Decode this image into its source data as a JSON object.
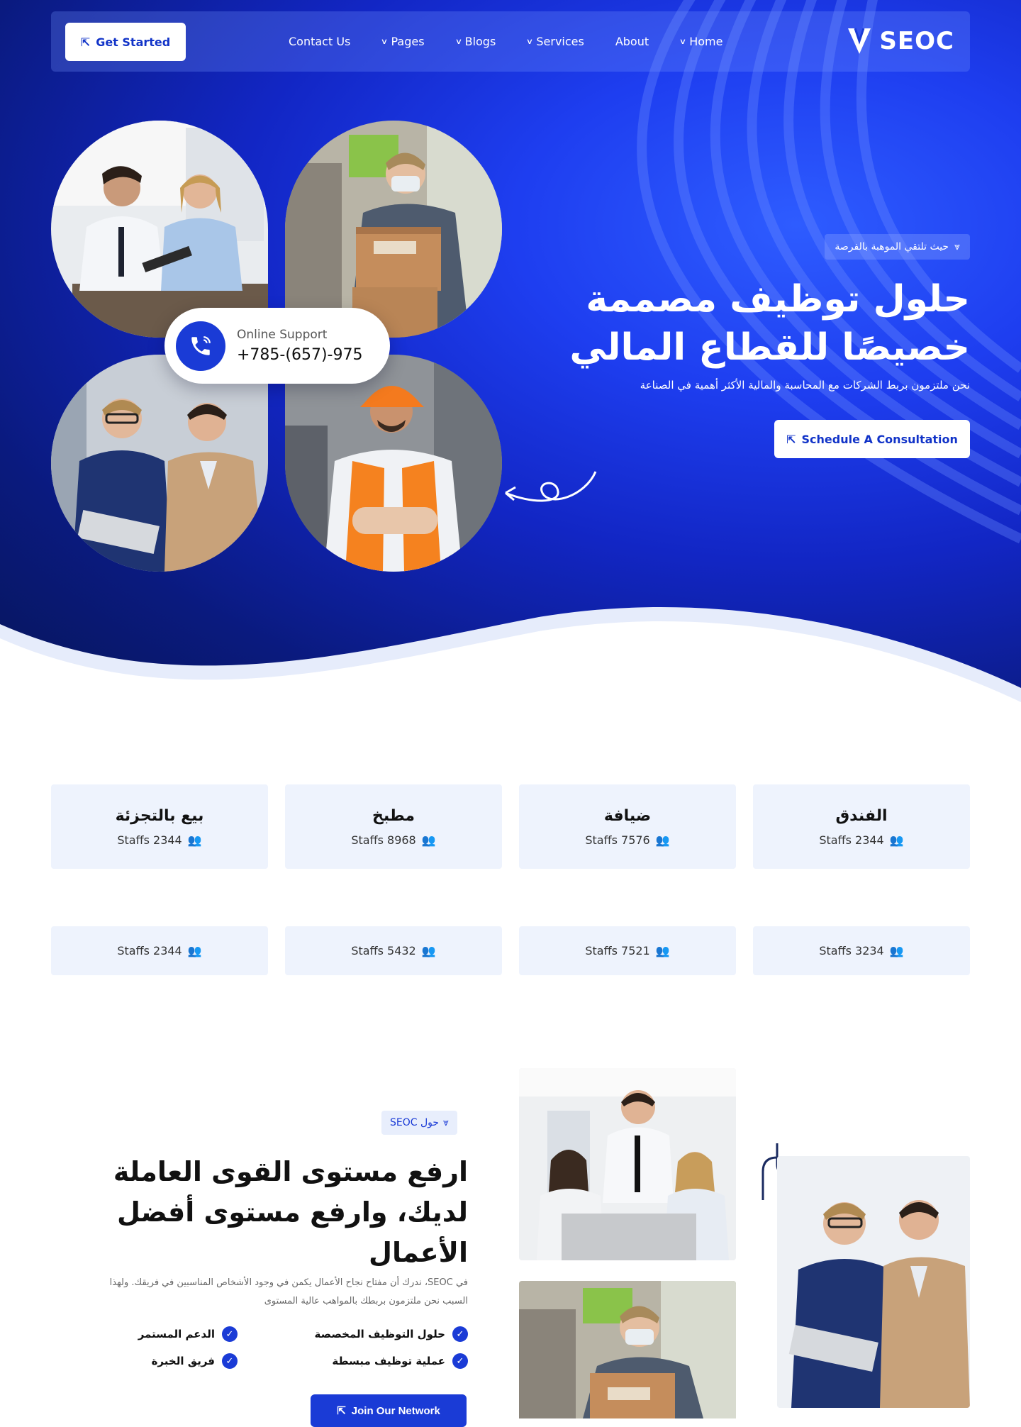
{
  "nav": {
    "cta_label": "Get Started",
    "links": [
      {
        "label": "Contact Us",
        "has_dropdown": false
      },
      {
        "label": "Pages",
        "has_dropdown": true
      },
      {
        "label": "Blogs",
        "has_dropdown": true
      },
      {
        "label": "Services",
        "has_dropdown": true
      },
      {
        "label": "About",
        "has_dropdown": false
      },
      {
        "label": "Home",
        "has_dropdown": true
      }
    ],
    "logo_text": "SEOC"
  },
  "hero": {
    "support_label": "Online Support",
    "support_phone": "+785-(657)-975",
    "badge": "حيث تلتقي الموهبة بالفرصة",
    "title_line1": "حلول توظيف مصممة",
    "title_line2": "خصيصًا للقطاع المالي",
    "subtitle": "نحن ملتزمون بربط الشركات مع المحاسبة والمالية الأكثر أهمية في الصناعة",
    "cta_label": "Schedule A Consultation"
  },
  "categories": [
    {
      "title": "الفندق",
      "staff": "Staffs 2344"
    },
    {
      "title": "ضيافة",
      "staff": "Staffs 7576"
    },
    {
      "title": "مطبخ",
      "staff": "Staffs 8968"
    },
    {
      "title": "بيع بالتجزئة",
      "staff": "Staffs 2344"
    },
    {
      "title": "",
      "staff": "Staffs 3234"
    },
    {
      "title": "",
      "staff": "Staffs 7521"
    },
    {
      "title": "",
      "staff": "Staffs 5432"
    },
    {
      "title": "",
      "staff": "Staffs 2344"
    }
  ],
  "about": {
    "badge": "حول SEOC",
    "title_line1": "ارفع مستوى القوى العاملة",
    "title_line2": "لديك، وارفع مستوى أفضل",
    "title_line3": "الأعمال",
    "desc_line1": "في SEOC، ندرك أن مفتاح نجاح الأعمال يكمن في وجود الأشخاص المناسبين في فريقك. ولهذا",
    "desc_line2": "السبب نحن ملتزمون بربطك بالمواهب عالية المستوى",
    "features": [
      "حلول التوظيف المخصصة",
      "الدعم المستمر",
      "عملية توظيف مبسطة",
      "فريق الخبرة"
    ],
    "cta_label": "Join Our Network"
  },
  "colors": {
    "brand": "#1a3bd6",
    "card_bg": "#eef3fd"
  }
}
